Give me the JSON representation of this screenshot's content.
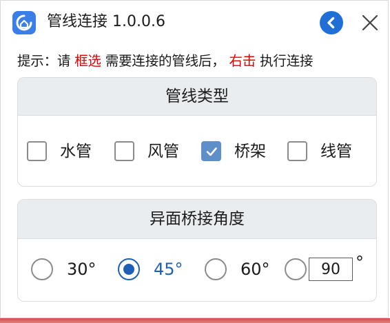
{
  "window": {
    "title": "管线连接 1.0.0.6",
    "accent_color": "#1f6fd6",
    "icons": {
      "app": "app-logo-icon",
      "back": "chevron-left-icon",
      "close": "close-icon"
    }
  },
  "tip": {
    "prefix": "提示：请 ",
    "highlight_1": "框选",
    "middle": " 需要连接的管线后，",
    "highlight_2": "右击",
    "suffix": " 执行连接",
    "highlight_color": "#e00000"
  },
  "pipe_types": {
    "header": "管线类型",
    "items": [
      {
        "label": "水管",
        "checked": false
      },
      {
        "label": "风管",
        "checked": false
      },
      {
        "label": "桥架",
        "checked": true
      },
      {
        "label": "线管",
        "checked": false
      }
    ]
  },
  "angles": {
    "header": "异面桥接角度",
    "options": [
      {
        "label": "30°",
        "checked": false
      },
      {
        "label": "45°",
        "checked": true
      },
      {
        "label": "60°",
        "checked": false
      }
    ],
    "custom_checked": false,
    "custom_value": "90",
    "custom_unit": "°"
  }
}
